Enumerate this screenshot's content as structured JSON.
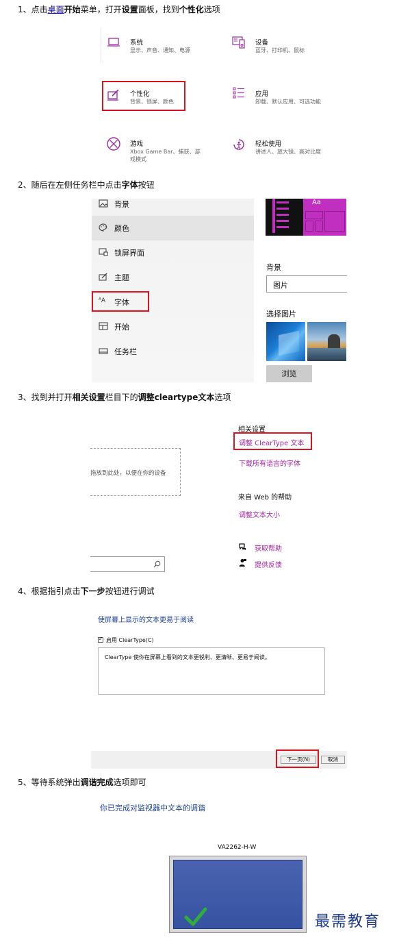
{
  "steps": {
    "s1": {
      "num": "1、",
      "p1": "点击",
      "link": "桌面",
      "p2": "开始",
      "p3": "菜单，打开",
      "p4": "设置",
      "p5": "面板，找到",
      "p6": "个性化",
      "p7": "选项"
    },
    "s2": {
      "p1": "2、随后在左侧任务栏中点击",
      "b1": "字体",
      "p2": "按钮"
    },
    "s3": {
      "p1": "3、找到并打开",
      "b1": "相关设置",
      "p2": "栏目下的",
      "b2": "调整cleartype文本",
      "p3": "选项"
    },
    "s4": {
      "p1": "4、根据指引点击",
      "b1": "下一步",
      "p2": "按钮进行调试"
    },
    "s5": {
      "p1": "5、等待系统弹出",
      "b1": "调谐完成",
      "p2": "选项即可"
    }
  },
  "settings_grid": [
    {
      "title": "系统",
      "sub": "显示、声音、通知、电源",
      "icon": "laptop-icon"
    },
    {
      "title": "设备",
      "sub": "蓝牙、打印机、鼠标",
      "icon": "devices-icon"
    },
    {
      "title": "个性化",
      "sub": "背景、锁屏、颜色",
      "icon": "personalization-icon"
    },
    {
      "title": "应用",
      "sub": "卸载、默认应用、可选功能",
      "icon": "apps-icon"
    },
    {
      "title": "游戏",
      "sub1": "Xbox Game Bar、捕获、游",
      "sub2": "戏模式",
      "icon": "xbox-icon"
    },
    {
      "title": "轻松使用",
      "sub": "讲述人、放大镜、高对比度",
      "icon": "ease-of-access-icon"
    }
  ],
  "personalization_nav": [
    {
      "label": "背景",
      "icon": "image-icon"
    },
    {
      "label": "颜色",
      "icon": "palette-icon"
    },
    {
      "label": "锁屏界面",
      "icon": "lock-screen-icon"
    },
    {
      "label": "主题",
      "icon": "theme-icon"
    },
    {
      "label": "字体",
      "icon": "font-icon"
    },
    {
      "label": "开始",
      "icon": "start-icon"
    },
    {
      "label": "任务栏",
      "icon": "taskbar-icon"
    }
  ],
  "background_panel": {
    "preview_text": "Aa",
    "label": "背景",
    "select_value": "图片",
    "choose_label": "选择图片",
    "browse_label": "浏览",
    "accent": "#c12fc0"
  },
  "fonts_page": {
    "drop_text": "拖放到此处，以便在你的设备",
    "related_heading": "相关设置",
    "cleartype_link": "调整 ClearType 文本",
    "download_link": "下载所有语言的字体",
    "help_heading": "来自 Web 的帮助",
    "text_size_link": "调整文本大小",
    "get_help": "获取帮助",
    "feedback": "提供反馈"
  },
  "cleartype_dialog": {
    "heading": "使屏幕上显示的文本更易于阅读",
    "checkbox_label": "启用 ClearType(C)",
    "description": "ClearType 使你在屏幕上看到的文本更锐利、更清晰、更易于阅读。",
    "next_button": "下一页(N)",
    "cancel_button": "取消"
  },
  "completion": {
    "heading": "你已完成对监视器中文本的调谐",
    "monitor_name": "VA2262-H-W"
  },
  "watermark": "最需教育",
  "colors": {
    "highlight_red": "#d9141e",
    "settings_purple": "#9b2aa3",
    "link_blue": "#1a0dab",
    "monitor_blue": "#3e5aa8"
  }
}
